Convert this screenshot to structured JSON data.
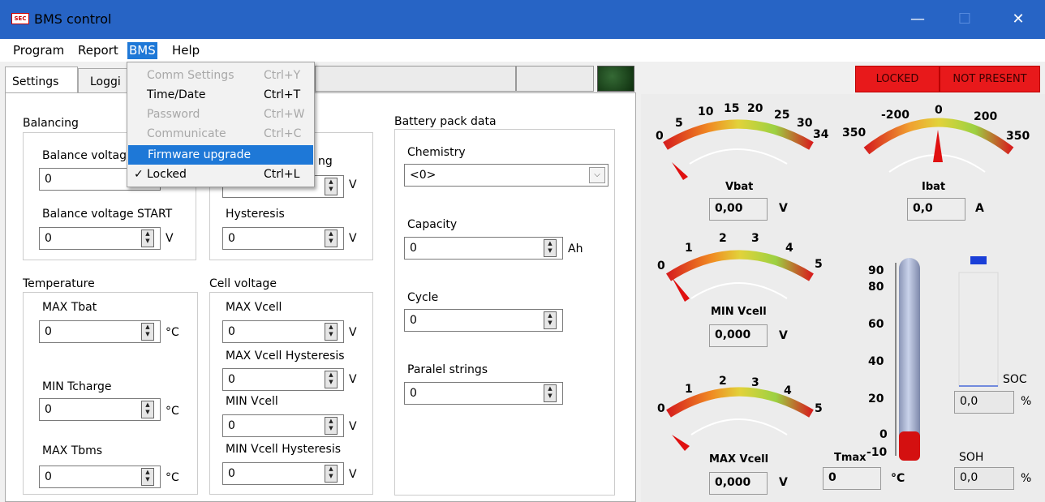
{
  "window": {
    "title": "BMS control",
    "icon_name": "app-logo-icon",
    "controls": {
      "minimize": "—",
      "maximize": "☐",
      "close": "✕"
    }
  },
  "menubar": {
    "program": "Program",
    "report": "Report",
    "bms": "BMS",
    "help": "Help"
  },
  "bms_menu": [
    {
      "label": "Comm Settings",
      "shortcut": "Ctrl+Y",
      "enabled": false
    },
    {
      "label": "Time/Date",
      "shortcut": "Ctrl+T",
      "enabled": true
    },
    {
      "label": "Password",
      "shortcut": "Ctrl+W",
      "enabled": false
    },
    {
      "label": "Communicate",
      "shortcut": "Ctrl+C",
      "enabled": false
    },
    {
      "label": "Firmware upgrade",
      "shortcut": "",
      "enabled": true,
      "highlighted": true
    },
    {
      "label": "Locked",
      "shortcut": "Ctrl+L",
      "enabled": true,
      "checked": true,
      "check": "✓"
    }
  ],
  "tabs": {
    "settings": "Settings",
    "logging": "Loggi"
  },
  "status": {
    "locked": "LOCKED",
    "not_present": "NOT PRESENT",
    "led_color": "#1f4d1f",
    "badge_color": "#e8191b"
  },
  "balancing": {
    "title": "Balancing",
    "voltage_label": "Balance voltag",
    "voltage_value": "0",
    "start_label": "Balance voltage START",
    "start_value": "0",
    "start_unit": "V",
    "partial_label": "ng",
    "partial_unit": "V",
    "hyst_label": "Hysteresis",
    "hyst_value": "0",
    "hyst_unit": "V"
  },
  "temperature": {
    "title": "Temperature",
    "max_tbat_label": "MAX Tbat",
    "max_tbat_value": "0",
    "max_tbat_unit": "°C",
    "min_tcharge_label": "MIN Tcharge",
    "min_tcharge_value": "0",
    "min_tcharge_unit": "°C",
    "max_tbms_label": "MAX Tbms",
    "max_tbms_value": "0",
    "max_tbms_unit": "°C"
  },
  "cell_voltage": {
    "title": "Cell voltage",
    "max_vcell_label": "MAX Vcell",
    "max_vcell_value": "0",
    "max_vcell_unit": "V",
    "max_hyst_label": "MAX Vcell Hysteresis",
    "max_hyst_value": "0",
    "max_hyst_unit": "V",
    "min_vcell_label": "MIN Vcell",
    "min_vcell_value": "0",
    "min_vcell_unit": "V",
    "min_hyst_label": "MIN Vcell Hysteresis",
    "min_hyst_value": "0",
    "min_hyst_unit": "V"
  },
  "battery_pack": {
    "title": "Battery pack data",
    "chemistry_label": "Chemistry",
    "chemistry_value": "<0>",
    "capacity_label": "Capacity",
    "capacity_value": "0",
    "capacity_unit": "Ah",
    "cycle_label": "Cycle",
    "cycle_value": "0",
    "strings_label": "Paralel strings",
    "strings_value": "0"
  },
  "gauges": {
    "vbat": {
      "label": "Vbat",
      "value": "0,00",
      "unit": "V",
      "ticks": [
        "0",
        "5",
        "10",
        "15",
        "20",
        "25",
        "30",
        "34"
      ],
      "needle_value": 0
    },
    "ibat": {
      "label": "Ibat",
      "value": "0,0",
      "unit": "A",
      "ticks": [
        "350",
        "-200",
        "0",
        "200",
        "350"
      ],
      "needle_value": 0
    },
    "min_vcell": {
      "label": "MIN Vcell",
      "value": "0,000",
      "unit": "V",
      "ticks": [
        "0",
        "1",
        "2",
        "3",
        "4",
        "5"
      ],
      "needle_value": 0
    },
    "max_vcell": {
      "label": "MAX Vcell",
      "value": "0,000",
      "unit": "V",
      "ticks": [
        "0",
        "1",
        "2",
        "3",
        "4",
        "5"
      ],
      "needle_value": 0
    }
  },
  "thermometer": {
    "label": "Tmax",
    "value": "0",
    "unit": "°C",
    "ticks": [
      "90",
      "80",
      "60",
      "40",
      "20",
      "0",
      "-10"
    ],
    "level": -10
  },
  "soc": {
    "label": "SOC",
    "value": "0,0",
    "unit": "%",
    "level": 0
  },
  "soh": {
    "label": "SOH",
    "value": "0,0",
    "unit": "%"
  }
}
